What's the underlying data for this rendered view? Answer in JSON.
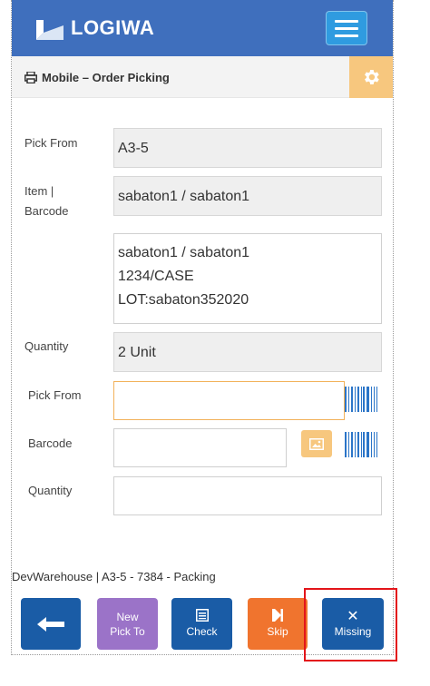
{
  "app": {
    "brand": "LOGIWA",
    "brand_color": "#3f6fbd",
    "accent_color": "#f7c77e"
  },
  "header": {
    "menu_icon": "hamburger-icon"
  },
  "subbar": {
    "title": "Mobile – Order Picking",
    "title_icon": "printer-icon",
    "settings_icon": "gear-icon"
  },
  "fields": {
    "pick_from_label": "Pick From",
    "pick_from_value": "A3-5",
    "item_label_line1": "Item |",
    "item_label_line2": "Barcode",
    "item_value": "sabaton1 / sabaton1",
    "info_line1": "sabaton1 / sabaton1",
    "info_line2": "1234/CASE",
    "info_line3": "LOT:sabaton352020",
    "quantity_label": "Quantity",
    "quantity_value": "2 Unit"
  },
  "inputs": {
    "pick_from_label": "Pick From",
    "pick_from_value": "",
    "barcode_label": "Barcode",
    "barcode_value": "",
    "quantity_label": "Quantity",
    "quantity_value": ""
  },
  "footer": {
    "status_text": "DevWarehouse | A3-5 - 7384 - Packing"
  },
  "buttons": {
    "back_icon": "arrow-left-icon",
    "new_line1": "New",
    "new_line2": "Pick To",
    "check": "Check",
    "check_icon": "list-icon",
    "skip": "Skip",
    "skip_icon": "skip-icon",
    "missing": "Missing",
    "missing_icon": "close-icon"
  }
}
